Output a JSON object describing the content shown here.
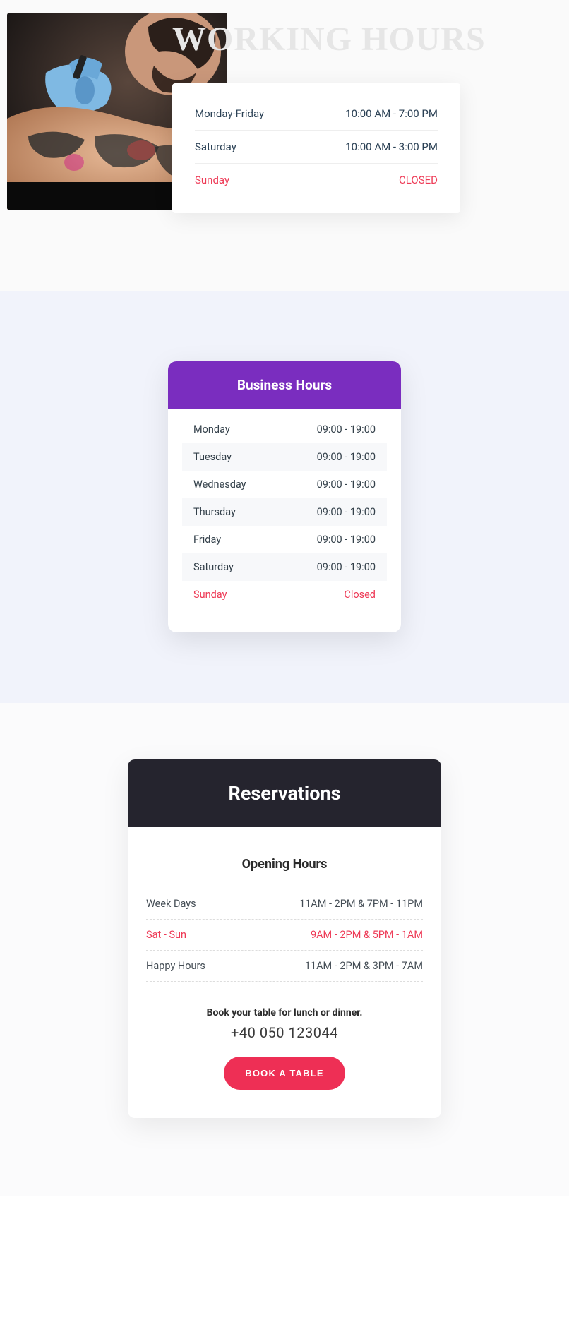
{
  "section1": {
    "title": "WORKING HOURS",
    "rows": [
      {
        "label": "Monday-Friday",
        "time": "10:00 AM - 7:00 PM",
        "closed": false
      },
      {
        "label": "Saturday",
        "time": "10:00 AM - 3:00 PM",
        "closed": false
      },
      {
        "label": "Sunday",
        "time": "CLOSED",
        "closed": true
      }
    ]
  },
  "section2": {
    "title": "Business Hours",
    "rows": [
      {
        "label": "Monday",
        "time": "09:00 - 19:00",
        "closed": false
      },
      {
        "label": "Tuesday",
        "time": "09:00 - 19:00",
        "closed": false
      },
      {
        "label": "Wednesday",
        "time": "09:00 - 19:00",
        "closed": false
      },
      {
        "label": "Thursday",
        "time": "09:00 - 19:00",
        "closed": false
      },
      {
        "label": "Friday",
        "time": "09:00 - 19:00",
        "closed": false
      },
      {
        "label": "Saturday",
        "time": "09:00 - 19:00",
        "closed": false
      },
      {
        "label": "Sunday",
        "time": "Closed",
        "closed": true
      }
    ]
  },
  "section3": {
    "title": "Reservations",
    "subtitle": "Opening Hours",
    "rows": [
      {
        "label": "Week Days",
        "time": "11AM - 2PM & 7PM - 11PM",
        "highlight": false
      },
      {
        "label": "Sat - Sun",
        "time": "9AM - 2PM & 5PM - 1AM",
        "highlight": true
      },
      {
        "label": "Happy Hours",
        "time": "11AM - 2PM & 3PM - 7AM",
        "highlight": false
      }
    ],
    "cta_text": "Book your table for lunch or dinner.",
    "phone": "+40 050 123044",
    "button": "BOOK A TABLE"
  }
}
